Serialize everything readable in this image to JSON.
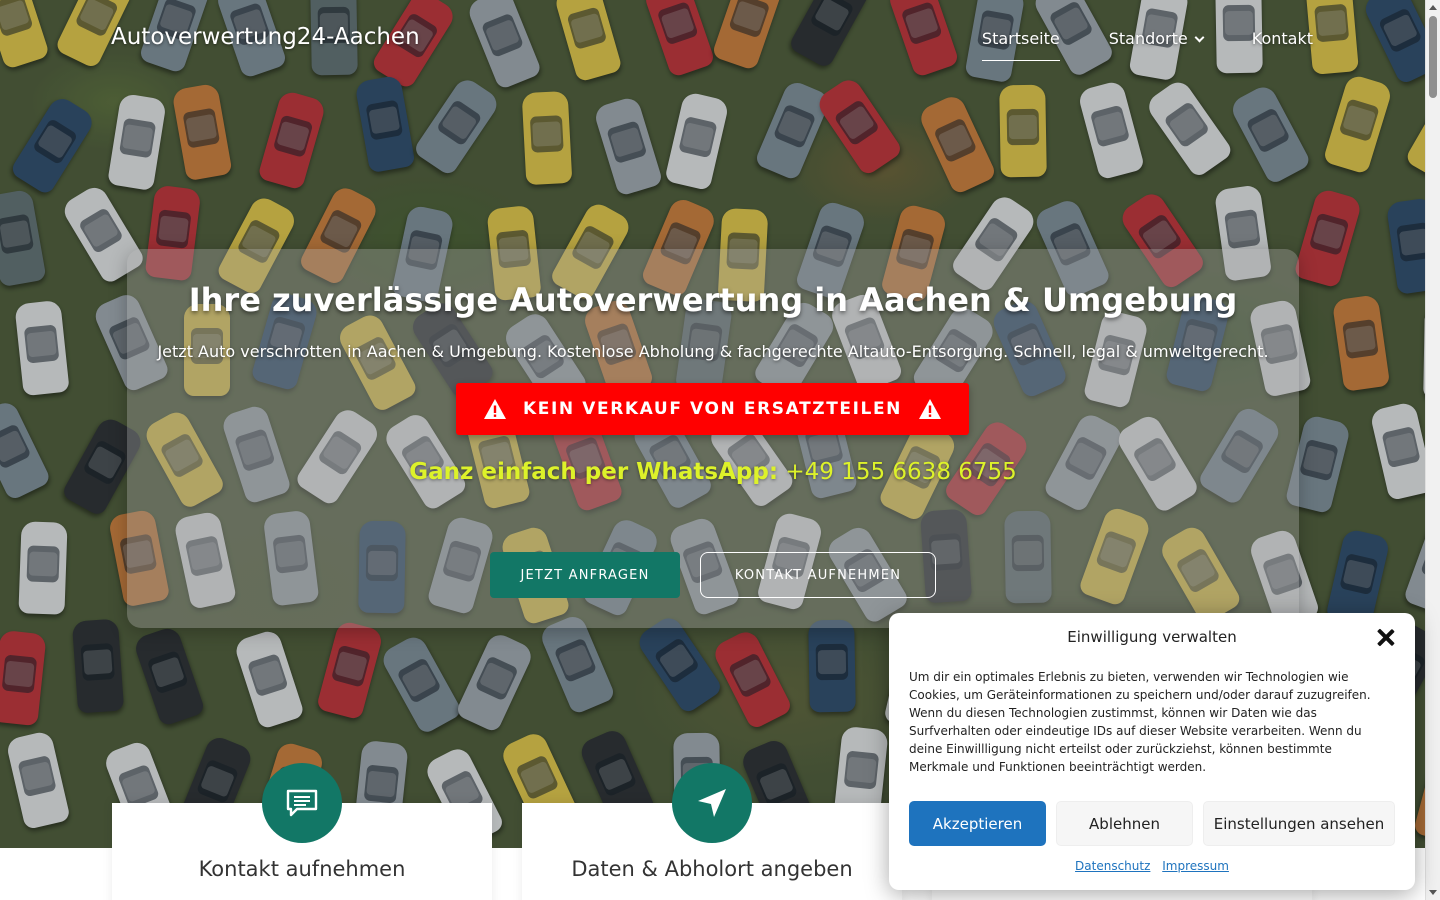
{
  "header": {
    "brand": "Autoverwertung24-Aachen",
    "nav": [
      {
        "label": "Startseite",
        "active": true
      },
      {
        "label": "Standorte",
        "has_dropdown": true
      },
      {
        "label": "Kontakt"
      }
    ]
  },
  "hero": {
    "title": "Ihre zuverlässige Autoverwertung in Aachen & Umgebung",
    "subtitle": "Jetzt Auto verschrotten in Aachen & Umgebung. Kostenlose Abholung & fachgerechte Altauto-Entsorgung. Schnell, legal & umweltgerecht.",
    "warning": "KEIN VERKAUF VON ERSATZTEILEN",
    "whatsapp_label": "Ganz einfach per WhatsApp:",
    "whatsapp_number": "+49 155 6638 6755",
    "cta_primary": "JETZT ANFRAGEN",
    "cta_secondary": "KONTAKT AUFNEHMEN"
  },
  "steps": [
    {
      "title": "Kontakt aufnehmen",
      "icon": "message-icon"
    },
    {
      "title": "Daten & Abholort angeben",
      "icon": "navigation-arrow-icon"
    }
  ],
  "consent": {
    "title": "Einwilligung verwalten",
    "body": "Um dir ein optimales Erlebnis zu bieten, verwenden wir Technologien wie Cookies, um Geräteinformationen zu speichern und/oder darauf zuzugreifen. Wenn du diesen Technologien zustimmst, können wir Daten wie das Surfverhalten oder eindeutige IDs auf dieser Website verarbeiten. Wenn du deine Einwillligung nicht erteilst oder zurückziehst, können bestimmte Merkmale und Funktionen beeinträchtigt werden.",
    "accept": "Akzeptieren",
    "deny": "Ablehnen",
    "view_settings": "Einstellungen ansehen",
    "link_privacy": "Datenschutz",
    "link_imprint": "Impressum"
  },
  "colors": {
    "brand_green": "#127766",
    "warning_red": "#ff0000",
    "whatsapp_yellow": "#ddf22a",
    "accept_blue": "#1e73be"
  }
}
